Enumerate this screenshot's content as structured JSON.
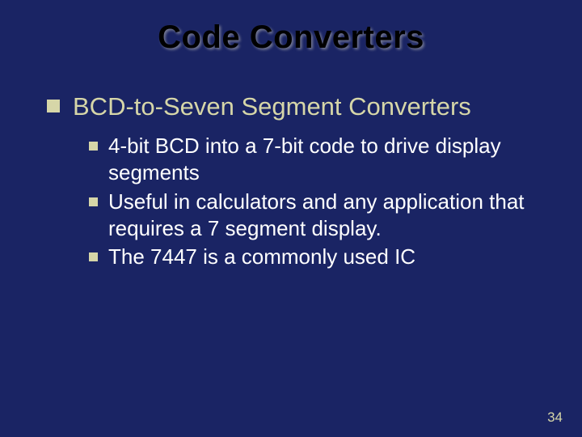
{
  "title": "Code Converters",
  "level1": {
    "heading": "BCD-to-Seven Segment Converters"
  },
  "level2": {
    "items": [
      "4-bit BCD into a 7-bit code to drive display segments",
      "Useful in calculators and any application that requires a 7 segment display.",
      "The 7447 is a commonly used IC"
    ]
  },
  "pageNumber": "34"
}
